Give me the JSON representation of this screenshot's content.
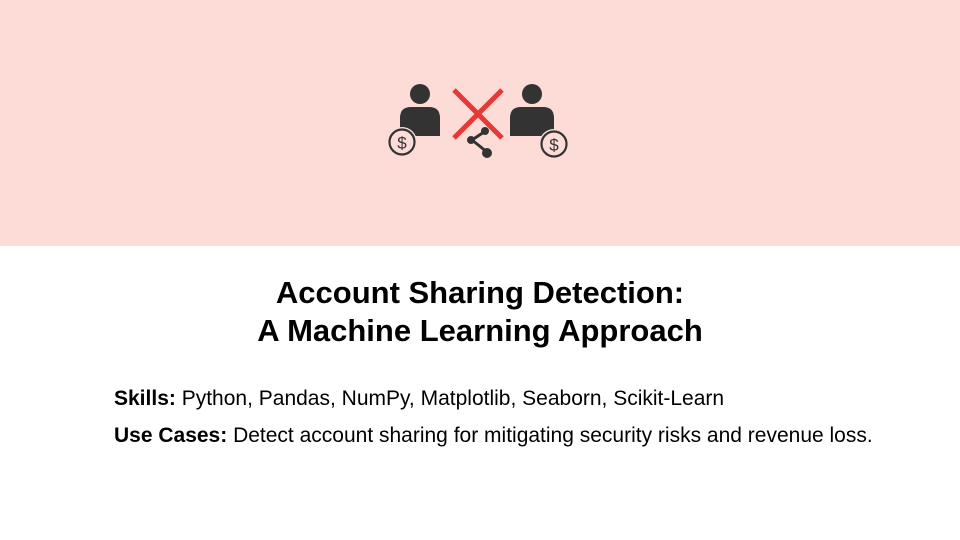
{
  "slide": {
    "banner_color": "#fddcd8",
    "illustration": {
      "icons": [
        "person-icon",
        "dollar-coin-icon",
        "cross-mark-icon",
        "share-icon",
        "person-icon",
        "dollar-coin-icon"
      ],
      "cross_color": "#e53935",
      "icon_color": "#333333"
    },
    "title_line1": "Account Sharing Detection:",
    "title_line2": "A Machine Learning Approach",
    "skills_label": "Skills:",
    "skills_value": " Python, Pandas, NumPy, Matplotlib, Seaborn, Scikit-Learn",
    "use_cases_label": "Use Cases:",
    "use_cases_value": " Detect account sharing for mitigating security risks and revenue loss."
  }
}
